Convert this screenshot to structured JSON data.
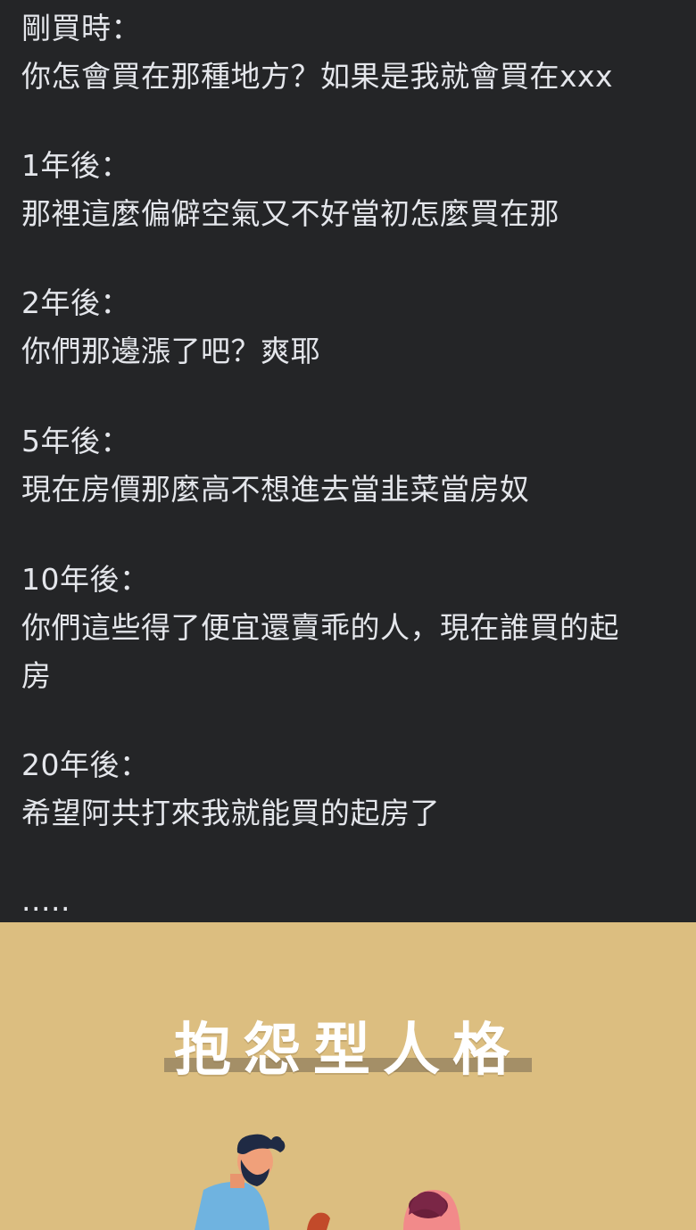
{
  "post": {
    "lines": [
      "剛買時：",
      "你怎會買在那種地方？如果是我就會買在xxx",
      "1年後：",
      "那裡這麼偏僻空氣又不好當初怎麼買在那",
      "2年後：",
      "你們那邊漲了吧？爽耶",
      "5年後：",
      "現在房價那麼高不想進去當韭菜當房奴",
      "10年後：",
      "你們這些得了便宜還賣乖的人，現在誰買的起",
      "房",
      "20年後：",
      "希望阿共打來我就能買的起房了",
      "....."
    ]
  },
  "image_card": {
    "title": "抱怨型人格",
    "background_color": "#dcbe80"
  }
}
